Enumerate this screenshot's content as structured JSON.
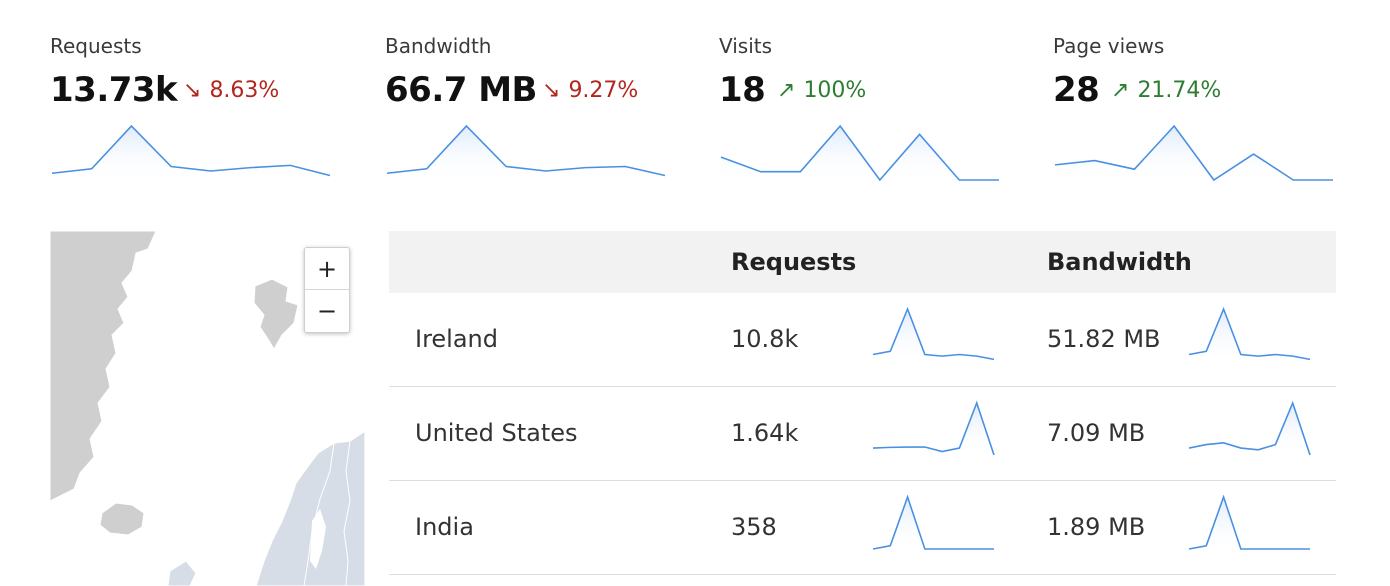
{
  "metrics": [
    {
      "label": "Requests",
      "value": "13.73k",
      "delta": "8.63%",
      "trend": "down",
      "series": [
        3,
        5,
        24,
        6,
        4,
        5.5,
        6.5,
        2
      ]
    },
    {
      "label": "Bandwidth",
      "value": "66.7 MB",
      "delta": "9.27%",
      "trend": "down",
      "series": [
        3,
        5,
        24,
        6,
        4,
        5.5,
        6,
        2
      ]
    },
    {
      "label": "Visits",
      "value": "18",
      "delta": "100%",
      "trend": "up",
      "series": [
        11,
        4,
        4,
        26,
        0,
        22,
        0,
        0
      ]
    },
    {
      "label": "Page views",
      "value": "28",
      "delta": "21.74%",
      "trend": "up",
      "series": [
        7,
        9,
        5,
        25,
        0,
        12,
        0,
        0
      ]
    }
  ],
  "map": {
    "zoom_in": "+",
    "zoom_out": "−",
    "land_color": "#cfcfcf",
    "highlight_color": "#d7dde6",
    "border_color": "#ffffff"
  },
  "table": {
    "headers": {
      "country": "",
      "requests": "Requests",
      "bandwidth": "Bandwidth"
    },
    "rows": [
      {
        "country": "Ireland",
        "requests": "10.8k",
        "req_series": [
          2,
          3,
          16,
          2,
          1.5,
          2,
          1.5,
          0.5
        ],
        "bandwidth": "51.82 MB",
        "bw_series": [
          2,
          3,
          16,
          2,
          1.5,
          2,
          1.5,
          0.5
        ]
      },
      {
        "country": "United States",
        "requests": "1.64k",
        "req_series": [
          2,
          2.2,
          2.3,
          2.3,
          1,
          2,
          15,
          0
        ],
        "bandwidth": "7.09 MB",
        "bw_series": [
          2,
          3,
          3.5,
          2,
          1.5,
          3,
          15,
          0
        ]
      },
      {
        "country": "India",
        "requests": "358",
        "req_series": [
          0,
          1,
          16,
          0,
          0,
          0,
          0,
          0
        ],
        "bandwidth": "1.89 MB",
        "bw_series": [
          0,
          1,
          16,
          0,
          0,
          0,
          0,
          0
        ]
      }
    ]
  },
  "colors": {
    "line": "#4a90e2",
    "fill_top": "#dbe8fb",
    "down": "#b3261e",
    "up": "#2e7d32",
    "header_bg": "#f2f2f2"
  }
}
